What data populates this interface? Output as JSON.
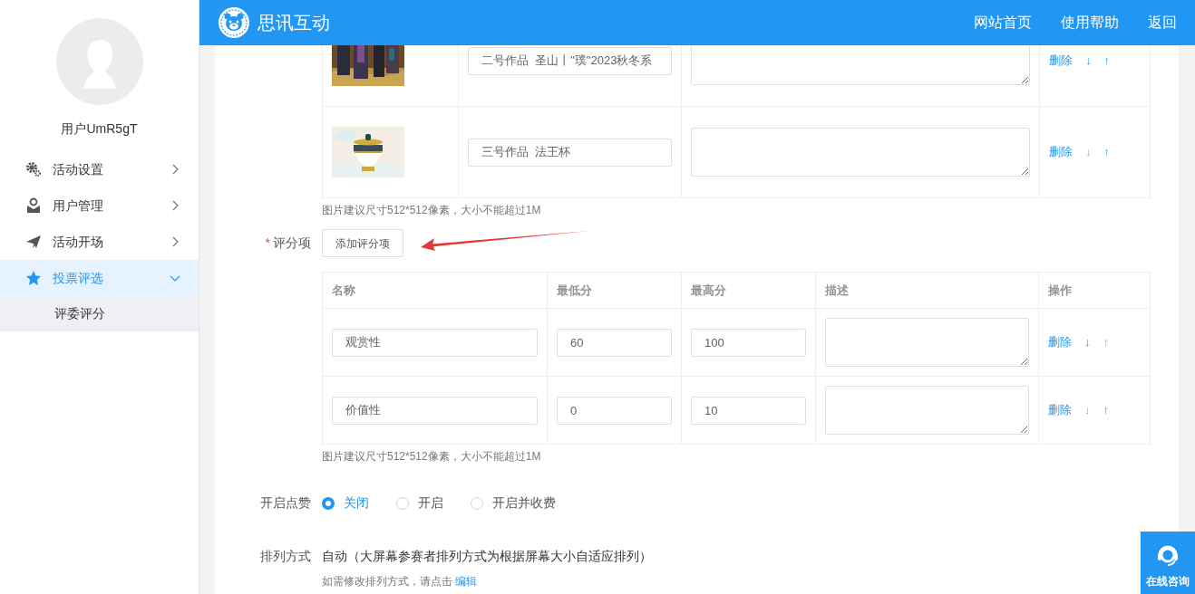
{
  "header": {
    "title": "思讯互动",
    "links": [
      "网站首页",
      "使用帮助",
      "返回"
    ]
  },
  "sidebar": {
    "username": "用户UmR5gT",
    "items": [
      {
        "label": "活动设置",
        "selected": false,
        "expanded": false
      },
      {
        "label": "用户管理",
        "selected": false,
        "expanded": false
      },
      {
        "label": "活动开场",
        "selected": false,
        "expanded": false
      },
      {
        "label": "投票评选",
        "selected": true,
        "expanded": true,
        "children": [
          {
            "label": "评委评分"
          }
        ]
      }
    ]
  },
  "works": {
    "rows": [
      {
        "name": "二号作品  圣山丨\"璞\"2023秋冬系",
        "delete": "删除",
        "down": "↓",
        "up": "↑",
        "down_enabled": true,
        "up_enabled": true
      },
      {
        "name": "三号作品  法王杯",
        "delete": "删除",
        "down": "↓",
        "up": "↑",
        "down_enabled": false,
        "up_enabled": true
      }
    ],
    "hint": "图片建议尺寸512*512像素，大小不能超过1M"
  },
  "scoring": {
    "required_mark": "*",
    "label": "评分项",
    "add_button": "添加评分项",
    "columns": [
      "名称",
      "最低分",
      "最高分",
      "描述",
      "操作"
    ],
    "rows": [
      {
        "name": "观赏性",
        "min": "60",
        "max": "100",
        "delete": "删除",
        "down": "↓",
        "up": "↑",
        "down_enabled": true,
        "up_enabled": false
      },
      {
        "name": "价值性",
        "min": "0",
        "max": "10",
        "delete": "删除",
        "down": "↓",
        "up": "↑",
        "down_enabled": false,
        "up_enabled": true
      }
    ],
    "hint": "图片建议尺寸512*512像素，大小不能超过1M"
  },
  "likes": {
    "label": "开启点赞",
    "options": [
      {
        "label": "关闭",
        "selected": true
      },
      {
        "label": "开启",
        "selected": false
      },
      {
        "label": "开启并收费",
        "selected": false
      }
    ]
  },
  "sort": {
    "label": "排列方式",
    "value": "自动（大屏幕参赛者排列方式为根据屏幕大小自适应排列）",
    "note": "如需修改排列方式，请点击",
    "link": "编辑"
  },
  "consult": {
    "label": "在线咨询"
  }
}
